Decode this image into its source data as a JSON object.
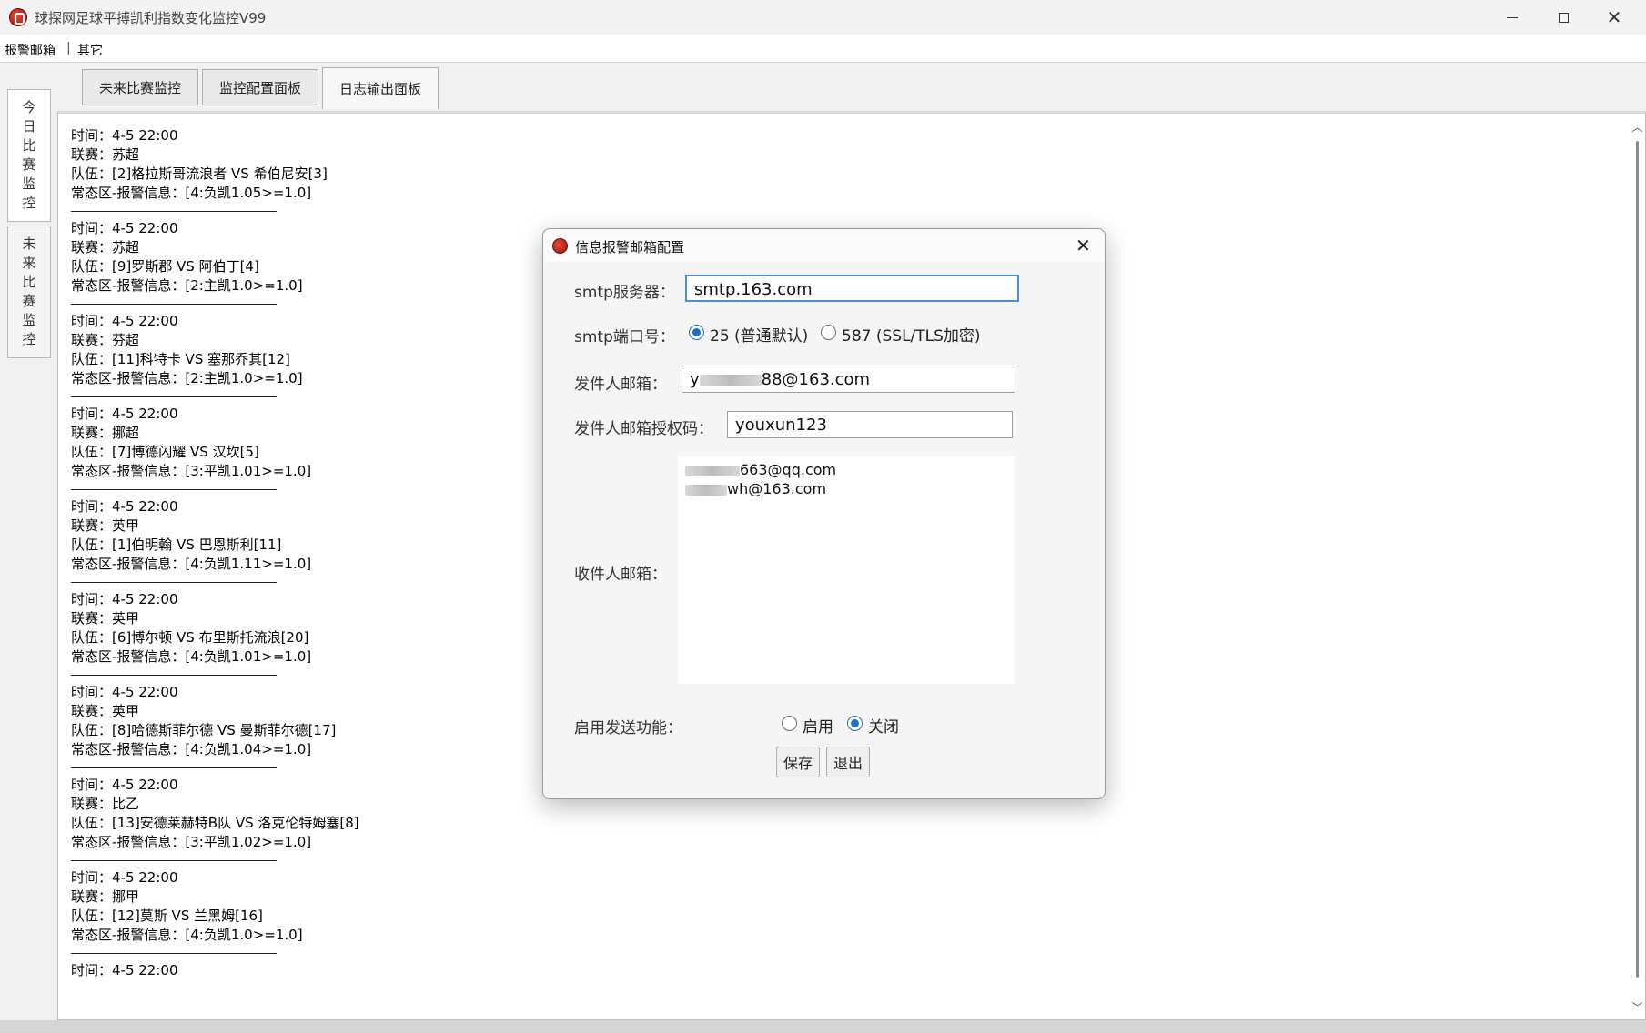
{
  "window": {
    "title": "球探网足球平搏凯利指数变化监控V99",
    "icon": "app-logo-icon"
  },
  "menu": [
    {
      "label": "报警邮箱"
    },
    {
      "label": "其它"
    }
  ],
  "menu_separator": "|",
  "left_tabs": {
    "today": "今日比赛监控",
    "future": "未来比赛监控"
  },
  "top_tabs": [
    {
      "label": "未来比赛监控"
    },
    {
      "label": "监控配置面板"
    },
    {
      "label": "日志输出面板"
    }
  ],
  "log_entries": [
    {
      "time": "时间：4-5 22:00",
      "league": "联赛：苏超",
      "teams": "队伍：[2]格拉斯哥流浪者 VS 希伯尼安[3]",
      "alert": "常态区-报警信息：[4:负凯1.05>=1.0]"
    },
    {
      "time": "时间：4-5 22:00",
      "league": "联赛：苏超",
      "teams": "队伍：[9]罗斯郡 VS 阿伯丁[4]",
      "alert": "常态区-报警信息：[2:主凯1.0>=1.0]"
    },
    {
      "time": "时间：4-5 22:00",
      "league": "联赛：芬超",
      "teams": "队伍：[11]科特卡 VS 塞那乔其[12]",
      "alert": "常态区-报警信息：[2:主凯1.0>=1.0]"
    },
    {
      "time": "时间：4-5 22:00",
      "league": "联赛：挪超",
      "teams": "队伍：[7]博德闪耀 VS 汉坎[5]",
      "alert": "常态区-报警信息：[3:平凯1.01>=1.0]"
    },
    {
      "time": "时间：4-5 22:00",
      "league": "联赛：英甲",
      "teams": "队伍：[1]伯明翰 VS 巴恩斯利[11]",
      "alert": "常态区-报警信息：[4:负凯1.11>=1.0]"
    },
    {
      "time": "时间：4-5 22:00",
      "league": "联赛：英甲",
      "teams": "队伍：[6]博尔顿 VS 布里斯托流浪[20]",
      "alert": "常态区-报警信息：[4:负凯1.01>=1.0]"
    },
    {
      "time": "时间：4-5 22:00",
      "league": "联赛：英甲",
      "teams": "队伍：[8]哈德斯菲尔德 VS 曼斯菲尔德[17]",
      "alert": "常态区-报警信息：[4:负凯1.04>=1.0]"
    },
    {
      "time": "时间：4-5 22:00",
      "league": "联赛：比乙",
      "teams": "队伍：[13]安德莱赫特B队 VS 洛克伦特姆塞[8]",
      "alert": "常态区-报警信息：[3:平凯1.02>=1.0]"
    },
    {
      "time": "时间：4-5 22:00",
      "league": "联赛：挪甲",
      "teams": "队伍：[12]莫斯 VS 兰黑姆[16]",
      "alert": "常态区-报警信息：[4:负凯1.0>=1.0]"
    }
  ],
  "log_partial": "时间：4-5 22:00",
  "dialog": {
    "title": "信息报警邮箱配置",
    "smtp_server_label": "smtp服务器：",
    "smtp_server_value": "smtp.163.com",
    "smtp_port_label": "smtp端口号：",
    "port_options": [
      {
        "label": "25 (普通默认)",
        "checked": true
      },
      {
        "label": "587 (SSL/TLS加密)",
        "checked": false
      }
    ],
    "sender_label": "发件人邮箱：",
    "sender_prefix": "y",
    "sender_suffix": "88@163.com",
    "auth_label": "发件人邮箱授权码：",
    "auth_value": "youxun123",
    "recipient_label": "收件人邮箱：",
    "recipients": [
      {
        "suffix": "663@qq.com"
      },
      {
        "suffix": "wh@163.com"
      }
    ],
    "enable_label": "启用发送功能：",
    "enable_options": [
      {
        "label": "启用",
        "checked": false
      },
      {
        "label": "关闭",
        "checked": true
      }
    ],
    "save_label": "保存",
    "exit_label": "退出"
  }
}
